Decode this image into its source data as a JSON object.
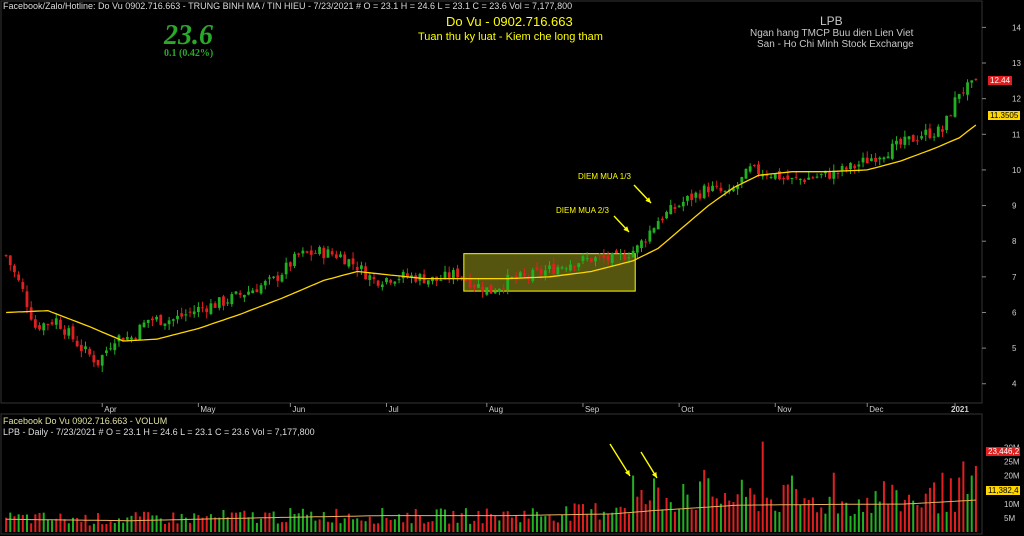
{
  "header": {
    "main_line": "Facebook/Zalo/Hotline: Do Vu 0902.716.663 - TRUNG BINH MA / TIN HIEU  - 7/23/2021  #  O = 23.1  H = 24.6  L = 23.1  C = 23.6  Vol = 7,177,800",
    "last_price": "23.6",
    "change": "0.1  (0.42%)",
    "author_name": "Do Vu - 0902.716.663",
    "slogan": "Tuan thu ky luat - Kiem che long tham",
    "ticker": "LPB",
    "company": "Ngan hang TMCP Buu dien Lien Viet",
    "exchange": "San - Ho Chi Minh Stock Exchange"
  },
  "volume_panel": {
    "title": "Facebook Do Vu 0902.716.663 - VOLUM",
    "info": "LPB - Daily  - 7/23/2021  #  O = 23.1  H = 24.6  L = 23.1  C = 23.6  Vol = 7,177,800",
    "last_volume_label": "23,446,2",
    "ma_volume_label": "11,382,4"
  },
  "price_badges": {
    "last": "12.44",
    "ma": "11.3505"
  },
  "annotations": {
    "buy1": "DIEM MUA 1/3",
    "buy2": "DIEM MUA 2/3"
  },
  "colors": {
    "up": "#22b022",
    "down": "#e02020",
    "ma": "#ffd700",
    "highlight_fill": "#9a9a1e",
    "highlight_stroke": "#ffff00",
    "arrow": "#ffff00",
    "grid": "#555555"
  },
  "chart_data": {
    "type": "candlestick",
    "price_axis": {
      "ticks": [
        4,
        5,
        6,
        7,
        8,
        9,
        10,
        11,
        12,
        13,
        14
      ],
      "ylim": [
        3.6,
        14.6
      ]
    },
    "volume_axis": {
      "ticks": [
        "5M",
        "10M",
        "15M",
        "20M",
        "25M",
        "30M"
      ],
      "tick_values": [
        5,
        10,
        15,
        20,
        25,
        30
      ],
      "ylim": [
        0,
        34
      ]
    },
    "months": [
      "Apr",
      "May",
      "Jun",
      "Jul",
      "Aug",
      "Sep",
      "Oct",
      "Nov",
      "Dec",
      "2021"
    ],
    "month_start_index": [
      23,
      46,
      68,
      91,
      115,
      138,
      161,
      184,
      206,
      227
    ],
    "n_bars": 233,
    "highlight_range": {
      "from_index": 110,
      "to_index": 151,
      "low": 6.6,
      "high": 7.65
    },
    "close_keypoints": [
      [
        0,
        7.6
      ],
      [
        4,
        6.6
      ],
      [
        7,
        5.6
      ],
      [
        12,
        5.8
      ],
      [
        18,
        5.0
      ],
      [
        22,
        4.6
      ],
      [
        26,
        5.3
      ],
      [
        30,
        5.3
      ],
      [
        34,
        5.8
      ],
      [
        40,
        5.8
      ],
      [
        46,
        6.1
      ],
      [
        52,
        6.3
      ],
      [
        58,
        6.6
      ],
      [
        64,
        6.9
      ],
      [
        70,
        7.6
      ],
      [
        75,
        7.7
      ],
      [
        80,
        7.6
      ],
      [
        84,
        7.3
      ],
      [
        88,
        6.9
      ],
      [
        93,
        7.0
      ],
      [
        98,
        7.0
      ],
      [
        103,
        6.9
      ],
      [
        108,
        7.1
      ],
      [
        112,
        6.8
      ],
      [
        116,
        6.6
      ],
      [
        120,
        6.9
      ],
      [
        125,
        7.0
      ],
      [
        130,
        7.2
      ],
      [
        135,
        7.4
      ],
      [
        140,
        7.5
      ],
      [
        146,
        7.5
      ],
      [
        151,
        7.8
      ],
      [
        156,
        8.6
      ],
      [
        162,
        9.1
      ],
      [
        168,
        9.5
      ],
      [
        173,
        9.3
      ],
      [
        178,
        10.0
      ],
      [
        183,
        9.9
      ],
      [
        188,
        9.7
      ],
      [
        193,
        9.8
      ],
      [
        198,
        9.9
      ],
      [
        203,
        10.1
      ],
      [
        208,
        10.4
      ],
      [
        214,
        10.7
      ],
      [
        219,
        11.0
      ],
      [
        224,
        11.1
      ],
      [
        228,
        12.2
      ],
      [
        233,
        12.44
      ]
    ],
    "ma_keypoints": [
      [
        0,
        6.0
      ],
      [
        10,
        6.05
      ],
      [
        20,
        5.6
      ],
      [
        28,
        5.2
      ],
      [
        36,
        5.25
      ],
      [
        46,
        5.55
      ],
      [
        56,
        5.95
      ],
      [
        66,
        6.4
      ],
      [
        76,
        6.9
      ],
      [
        84,
        7.15
      ],
      [
        92,
        7.05
      ],
      [
        100,
        6.95
      ],
      [
        110,
        6.95
      ],
      [
        120,
        6.95
      ],
      [
        130,
        7.0
      ],
      [
        140,
        7.15
      ],
      [
        150,
        7.45
      ],
      [
        156,
        7.8
      ],
      [
        162,
        8.4
      ],
      [
        168,
        9.0
      ],
      [
        174,
        9.5
      ],
      [
        180,
        9.85
      ],
      [
        188,
        9.95
      ],
      [
        196,
        9.95
      ],
      [
        206,
        10.0
      ],
      [
        214,
        10.25
      ],
      [
        222,
        10.6
      ],
      [
        228,
        10.9
      ],
      [
        233,
        11.35
      ]
    ],
    "volume_keypoints": [
      [
        0,
        5
      ],
      [
        20,
        4.5
      ],
      [
        40,
        5
      ],
      [
        60,
        5.5
      ],
      [
        80,
        6
      ],
      [
        100,
        5.5
      ],
      [
        120,
        6
      ],
      [
        140,
        7
      ],
      [
        150,
        11
      ],
      [
        155,
        12
      ],
      [
        170,
        13
      ],
      [
        180,
        12
      ],
      [
        200,
        10
      ],
      [
        220,
        12
      ],
      [
        233,
        14
      ]
    ],
    "volume_ma_keypoints": [
      [
        0,
        4.5
      ],
      [
        30,
        4.0
      ],
      [
        60,
        5.0
      ],
      [
        90,
        5.8
      ],
      [
        120,
        5.8
      ],
      [
        145,
        6.4
      ],
      [
        155,
        7.6
      ],
      [
        175,
        9.5
      ],
      [
        200,
        9.8
      ],
      [
        215,
        9.9
      ],
      [
        233,
        11.38
      ]
    ],
    "volume_spikes": [
      [
        150,
        20
      ],
      [
        155,
        19
      ],
      [
        162,
        17
      ],
      [
        167,
        22
      ],
      [
        181,
        32
      ],
      [
        188,
        20
      ],
      [
        198,
        21
      ],
      [
        210,
        18
      ],
      [
        224,
        21
      ],
      [
        229,
        25
      ],
      [
        232,
        23.4
      ]
    ]
  }
}
